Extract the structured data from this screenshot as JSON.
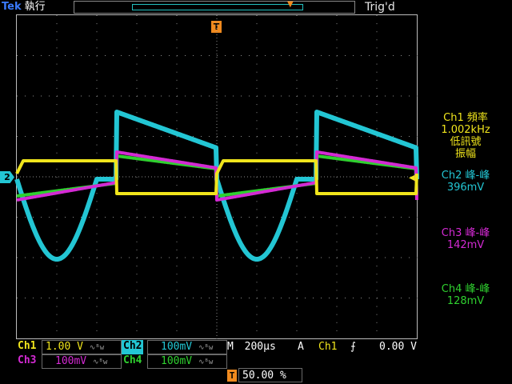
{
  "header": {
    "brand": "Tek",
    "run_state": "執行",
    "trigger_status": "Trig'd",
    "trigger_marker": "T",
    "timebase_marker_icon": "trigger-position-icon"
  },
  "channel_markers": {
    "ch2": "2"
  },
  "measurements": {
    "ch1": {
      "line1": "Ch1 頻率",
      "line2": "1.002kHz",
      "line3": "低訊號",
      "line4": "振幅"
    },
    "ch2": {
      "line1": "Ch2 峰-峰",
      "line2": "396mV"
    },
    "ch3": {
      "line1": "Ch3 峰-峰",
      "line2": "142mV"
    },
    "ch4": {
      "line1": "Ch4 峰-峰",
      "line2": "128mV"
    }
  },
  "readouts": {
    "ch1_label": "Ch1",
    "ch1_scale": "1.00 V",
    "ch2_label": "Ch2",
    "ch2_scale": "100mV",
    "ch3_label": "Ch3",
    "ch3_scale": "100mV",
    "ch4_label": "Ch4",
    "ch4_scale": "100mV",
    "bw_symbol": "∿ᴮw",
    "timebase_label": "M",
    "timebase_value": "200µs",
    "trigger_mode": "A",
    "trigger_source": "Ch1",
    "trigger_slope": "⨍",
    "trigger_level": "0.00 V",
    "trigger_position_marker": "T",
    "trigger_position": "50.00 %"
  },
  "colors": {
    "ch1": "#f0e51c",
    "ch2": "#23c6d4",
    "ch3": "#d42ad4",
    "ch4": "#2fd02f",
    "trigger": "#f08a1e",
    "grid": "#8c8c8c"
  }
}
